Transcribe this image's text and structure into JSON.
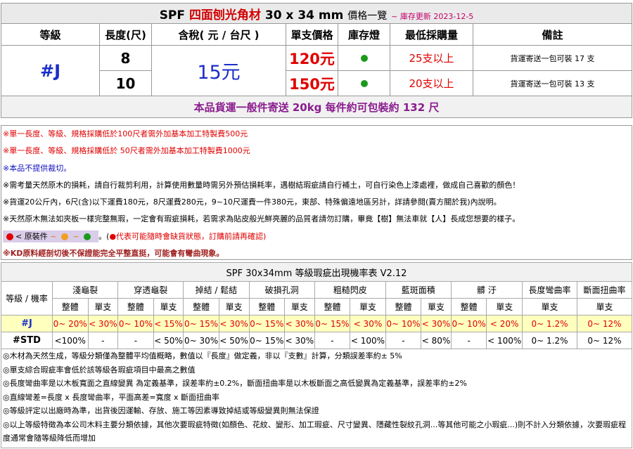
{
  "header": {
    "brand": "SPF",
    "product": "四面刨光角材",
    "size": "30 x 34 mm",
    "suffix": "價格一覽",
    "updated": "~ 庫存更新 2023-12-5"
  },
  "columns": [
    "等級",
    "長度(尺)",
    "含稅( 元 / 台尺 )",
    "單支價格",
    "庫存燈",
    "最低採購量",
    "備註"
  ],
  "grade": "#J",
  "price_per_unit": "15元",
  "rows": [
    {
      "length": "8",
      "unit_price": "120元",
      "min_buy": "25支以上",
      "note": "貨運寄送一包可裝 17 支"
    },
    {
      "length": "10",
      "unit_price": "150元",
      "min_buy": "20支以上",
      "note": "貨運寄送一包可裝 13 支"
    }
  ],
  "stock_color": "#1a9a1a",
  "shipping_note": "本品貨運一般件寄送 20kg 每件約可包裝約 132 尺",
  "notes": [
    "※單一長度、等級、規格採購低於100尺者需外加基本加工特製費500元",
    "※單一長度、等級、規格採購低於 50尺者需外加基本加工特製費1000元",
    "※本品不提供裁切。",
    "※需考量天然原木的損耗，請自行裁剪利用，計算使用數量時需另外預估損耗率，遇樹結瑕疵請自行補土，可自行染色上漆處裡，做成自己喜歡的顏色！",
    "※貨運20公斤內，6尺(含)以下運費180元，8尺運費280元，9~10尺運費一件380元，東部、特殊偏遠地區另計，詳請參閱(賣方關於我)內說明。",
    "※天然原木無法如夾板一樣完整無瑕，一定會有瑕疵損耗，若需求為貼皮般光鮮亮麗的品質者請勿訂購，畢竟【樹】無法車就【人】長成您想要的樣子。"
  ],
  "legend": {
    "label": "< 原裝件",
    "sep1": "~",
    "sep2": "~",
    "tail": "。(",
    "warning": "●代表可能隨時會缺貨狀態，訂購前請再確認)"
  },
  "kd_note": "※KD原料經剖切後不保證能完全平整直挺，可能會有彎曲現象。",
  "defect_table": {
    "title": "SPF 30x34mm 等級瑕疵出現機率表 V2.12",
    "corner": "等級 / 機率",
    "groups": [
      "淺龜裂",
      "穿透龜裂",
      "掉結 / 鬆結",
      "破損孔洞",
      "粗糙閃皮",
      "藍斑面積",
      "髒 汙",
      "長度彎曲率",
      "斷面扭曲率"
    ],
    "sub_whole": "整體",
    "sub_single": "單支",
    "rows": [
      {
        "grade": "#J",
        "cells": [
          "0~ 20%",
          "< 30%",
          "0~ 10%",
          "< 15%",
          "0~ 15%",
          "< 30%",
          "0~ 15%",
          "< 30%",
          "0~ 15%",
          "< 30%",
          "0~ 10%",
          "< 30%",
          "0~ 10%",
          "< 20%",
          "0~ 1.2%",
          "0~ 12%"
        ]
      },
      {
        "grade": "#STD",
        "cells": [
          "<100%",
          "-",
          "-",
          "< 50%",
          "0~ 30%",
          "< 50%",
          "0~ 15%",
          "< 30%",
          "-",
          "< 100%",
          "-",
          "< 80%",
          "-",
          "< 100%",
          "0~ 1.2%",
          "0~ 12%"
        ]
      }
    ]
  },
  "footnotes": [
    "◎木材為天然生成，等級分類僅為整體平均值概略，數值以『長度』做定義，非以『支數』計算，分類誤差率約± 5%",
    "◎單支綜合瑕疵率會低於該等級各瑕疵項目中最高之數值",
    "◎長度彎曲率是以木板寬面之直線變異 為定義基準，誤差率約±0.2%，斷面扭曲率是以木板斷面之高低變異為定義基準，誤差率約±2%",
    "◎直線彎差=長度 x 長度彎曲率，平面高差=寬度 x 斷面扭曲率",
    "◎等級評定以出廠時為準，出貨後因運輸、存放、施工等因素導致掉結或等級變異則無法保證",
    "◎以上等級特徵為本公司木料主要分類依據，其他次要瑕疵特徵(如顏色、花紋、變形、加工瑕疵、尺寸變異、隱藏性裂紋孔洞...等其他可能之小瑕疵...)則不計入分類依據，次要瑕疵程度通常會隨等級降低而增加"
  ]
}
